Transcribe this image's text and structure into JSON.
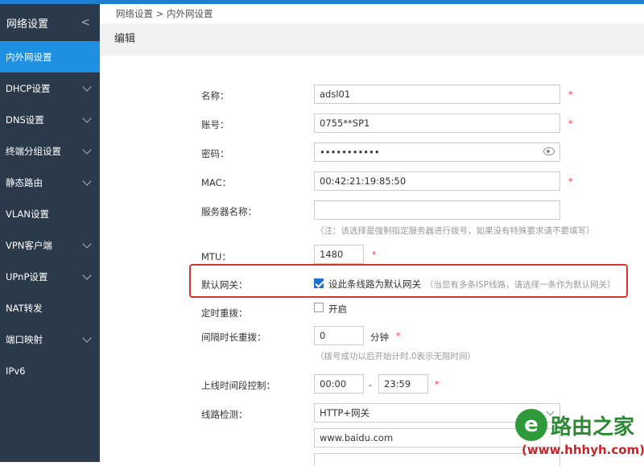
{
  "sidebar": {
    "header": "网络设置",
    "items": [
      {
        "label": "内外网设置",
        "active": true,
        "expandable": false
      },
      {
        "label": "DHCP设置",
        "active": false,
        "expandable": true
      },
      {
        "label": "DNS设置",
        "active": false,
        "expandable": true
      },
      {
        "label": "终端分组设置",
        "active": false,
        "expandable": true
      },
      {
        "label": "静态路由",
        "active": false,
        "expandable": true
      },
      {
        "label": "VLAN设置",
        "active": false,
        "expandable": false
      },
      {
        "label": "VPN客户端",
        "active": false,
        "expandable": true
      },
      {
        "label": "UPnP设置",
        "active": false,
        "expandable": true
      },
      {
        "label": "NAT转发",
        "active": false,
        "expandable": false
      },
      {
        "label": "端口映射",
        "active": false,
        "expandable": true
      },
      {
        "label": "IPv6",
        "active": false,
        "expandable": false
      }
    ]
  },
  "breadcrumb": "网络设置 > 内外网设置",
  "section_title": "编辑",
  "form": {
    "name": {
      "label": "名称：",
      "value": "adsl01",
      "required": "*"
    },
    "account": {
      "label": "账号：",
      "value": "0755**SP1",
      "required": "*"
    },
    "password": {
      "label": "密码：",
      "value": "•••••••••••",
      "required": "*"
    },
    "mac": {
      "label": "MAC：",
      "value": "00:42:21:19:85:50",
      "required": "*"
    },
    "server_name": {
      "label": "服务器名称：",
      "value": "",
      "hint": "（注：该选择是强制指定服务器进行拨号，如果没有特殊要求请不要填写）"
    },
    "mtu": {
      "label": "MTU：",
      "value": "1480",
      "required": "*"
    },
    "default_gateway": {
      "label": "默认网关：",
      "checkbox_label": "设此条线路为默认网关",
      "checked": true,
      "hint": "（当您有多条ISP线路，请选择一条作为默认网关）"
    },
    "scheduled_redial": {
      "label": "定时重拨：",
      "checkbox_label": "开启",
      "checked": false
    },
    "interval_redial": {
      "label": "间隔时长重拨：",
      "value": "0",
      "unit": "分钟",
      "required": "*",
      "hint": "（拨号成功以后开始计时,0表示无限时间）"
    },
    "online_time": {
      "label": "上线时间段控制：",
      "start": "00:00",
      "separator": "-",
      "end": "23:59",
      "required": "*"
    },
    "line_detect": {
      "label": "线路检测：",
      "selected": "HTTP+网关",
      "url": "www.baidu.com"
    }
  },
  "watermark": {
    "logo_char": "e",
    "title": "路由之家",
    "url": "(www.hhhyh.com)"
  },
  "colors": {
    "sidebar_bg": "#2b3a4a",
    "active": "#1e8fe1",
    "top_bar": "#1d7fcf",
    "highlight_box": "#d9342b",
    "required": "#e4393c"
  }
}
